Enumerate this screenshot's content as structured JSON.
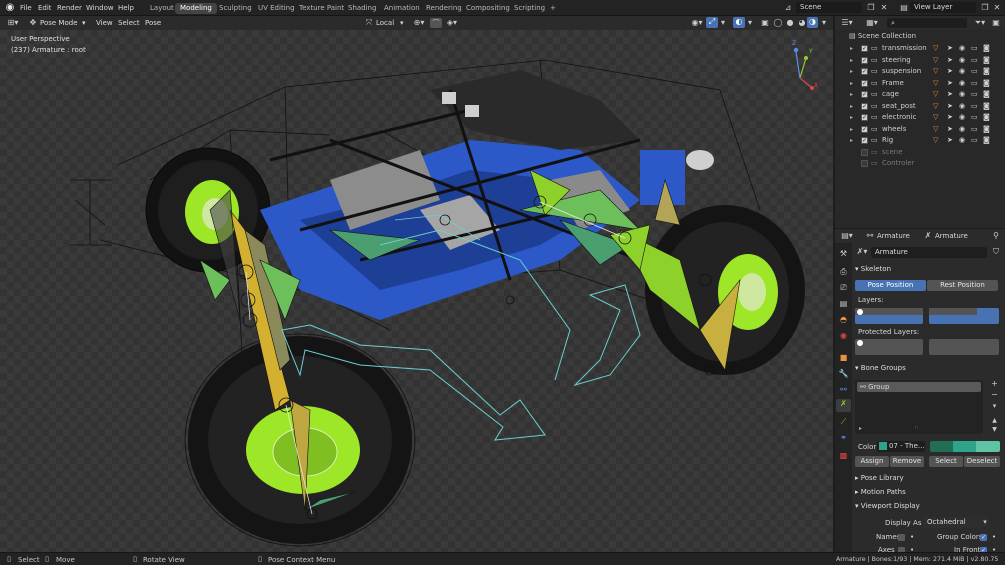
{
  "topbar": {
    "menus": [
      "File",
      "Edit",
      "Render",
      "Window",
      "Help"
    ],
    "workspaces": [
      "Layout",
      "Modeling",
      "Sculpting",
      "UV Editing",
      "Texture Paint",
      "Shading",
      "Animation",
      "Rendering",
      "Compositing",
      "Scripting"
    ],
    "active_workspace": "Modeling",
    "add_tab": "+",
    "scene": "Scene",
    "view_layer": "View Layer"
  },
  "viewport_header": {
    "mode": "Pose Mode",
    "menus": [
      "View",
      "Select",
      "Pose"
    ],
    "transform_orientation": "Local"
  },
  "viewport": {
    "perspective": "User Perspective",
    "object_info": "(237) Armature : root",
    "axes": {
      "x": "X",
      "y": "Y",
      "z": "Z"
    }
  },
  "outliner": {
    "root": "Scene Collection",
    "items": [
      {
        "name": "transmission",
        "enabled": true
      },
      {
        "name": "steering",
        "enabled": true
      },
      {
        "name": "suspension",
        "enabled": true
      },
      {
        "name": "Frame",
        "enabled": true
      },
      {
        "name": "cage",
        "enabled": true
      },
      {
        "name": "seat_post",
        "enabled": true
      },
      {
        "name": "electronic",
        "enabled": true
      },
      {
        "name": "wheels",
        "enabled": true
      },
      {
        "name": "Rig",
        "enabled": true
      },
      {
        "name": "scene",
        "enabled": false
      },
      {
        "name": "Controler",
        "enabled": false
      }
    ]
  },
  "properties": {
    "breadcrumb": [
      "Armature",
      "Armature"
    ],
    "data_name": "Armature",
    "skeleton": {
      "title": "Skeleton",
      "pose_position": "Pose Position",
      "rest_position": "Rest Position",
      "layers_label": "Layers:",
      "protected_label": "Protected Layers:"
    },
    "bone_groups": {
      "title": "Bone Groups",
      "group": "Group",
      "color_label": "Color",
      "color_value": "07 - The...",
      "assign": "Assign",
      "remove": "Remove",
      "select": "Select",
      "deselect": "Deselect"
    },
    "pose_library": "Pose Library",
    "motion_paths": "Motion Paths",
    "viewport_display": {
      "title": "Viewport Display",
      "display_as_label": "Display As",
      "display_as_value": "Octahedral",
      "names": "Names",
      "group_colors": "Group Colors",
      "axes": "Axes",
      "in_front": "In Front"
    }
  },
  "status": {
    "select": "Select",
    "move": "Move",
    "rotate": "Rotate View",
    "context": "Pose Context Menu",
    "info": "Armature | Bones:1/93 | Mem: 271.4 MiB | v2.80.75"
  },
  "colors": {
    "accent": "#4772b3",
    "bone_green": "#8fd12b",
    "wheel_green": "#9ee628",
    "chassis_blue": "#2d59c8",
    "active_orange": "#e88a2a"
  }
}
